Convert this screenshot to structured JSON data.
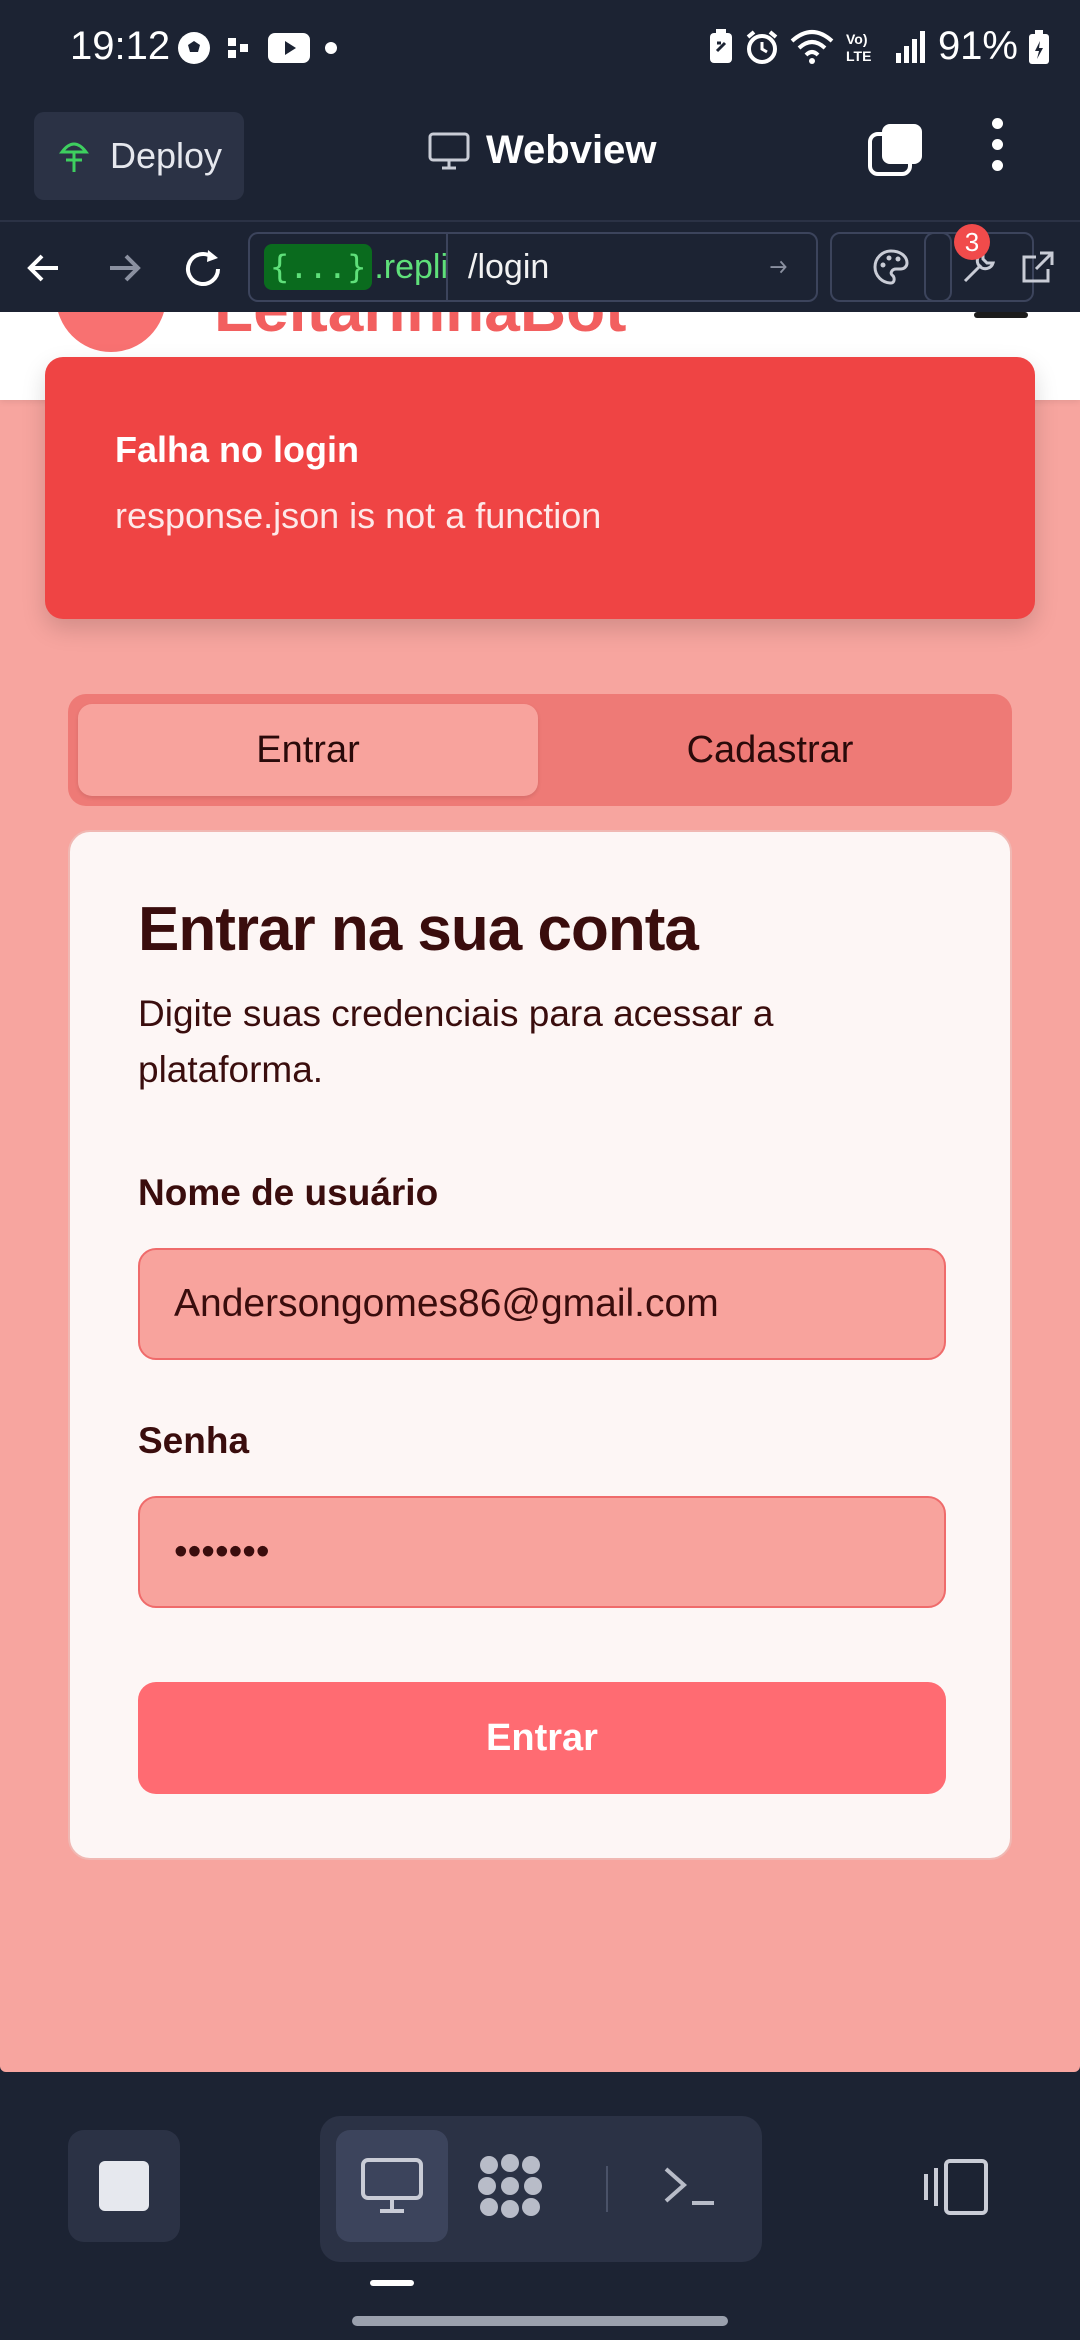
{
  "status_bar": {
    "time": "19:12",
    "battery": "91%",
    "left_icons": [
      "soccer-ball-icon",
      "dots-icon",
      "youtube-icon",
      "dot-icon"
    ],
    "right_icons": [
      "battery-saver-icon",
      "alarm-icon",
      "wifi-icon",
      "volte-icon",
      "signal-icon",
      "battery-icon"
    ]
  },
  "topbar": {
    "deploy_label": "Deploy",
    "title": "Webview"
  },
  "urlbar": {
    "host_badge": "{...}",
    "host_domain": ".replit.c",
    "path": "/login",
    "notification_count": "3"
  },
  "site": {
    "logo_part1": "LeitarinhaBot",
    "logo_part2": ""
  },
  "toast": {
    "title": "Falha no login",
    "message": "response.json is not a function"
  },
  "tabs": {
    "login": "Entrar",
    "register": "Cadastrar"
  },
  "card": {
    "title": "Entrar na sua conta",
    "description": "Digite suas credenciais para acessar a plataforma.",
    "username_label": "Nome de usuário",
    "username_value": "Andersongomes86@gmail.com",
    "password_label": "Senha",
    "password_value": "•••••••",
    "submit_label": "Entrar"
  },
  "colors": {
    "app_bg": "#1c2333",
    "page_bg": "#f7a59f",
    "toast_bg": "#ef4444",
    "button": "#ff6b72"
  }
}
